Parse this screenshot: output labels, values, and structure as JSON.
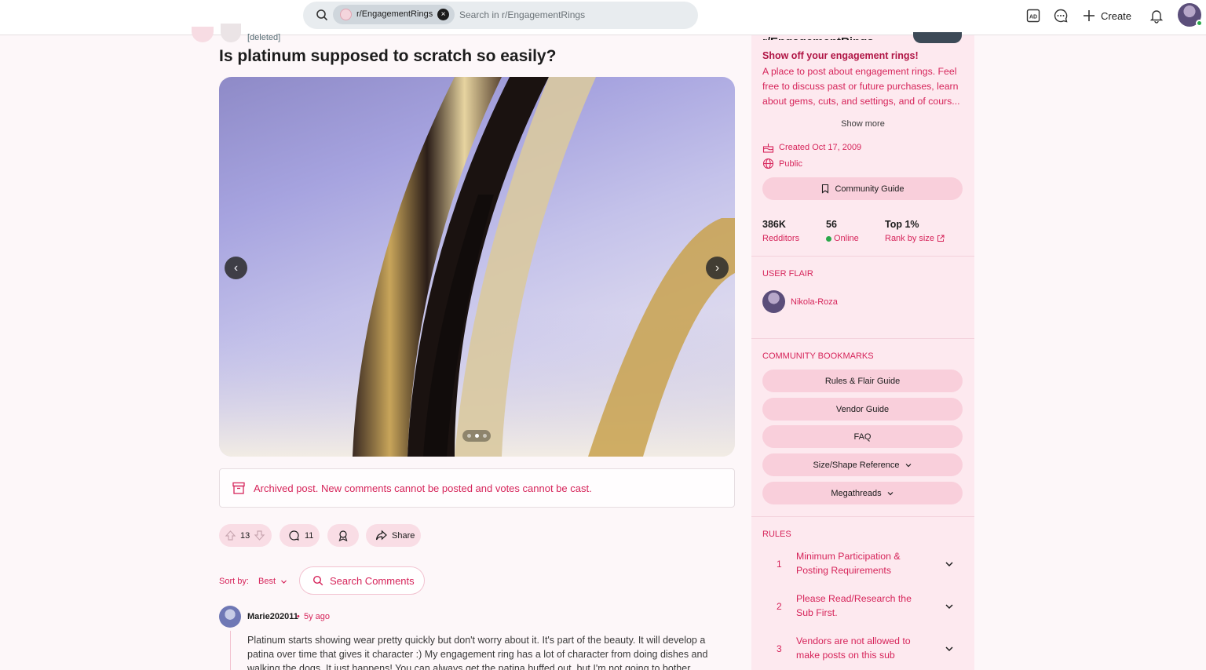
{
  "header": {
    "search_chip_label": "r/EngagementRings",
    "search_placeholder": "Search in r/EngagementRings",
    "create_label": "Create"
  },
  "post": {
    "author": "[deleted]",
    "title": "Is platinum supposed to scratch so easily?",
    "gallery_index": 2,
    "gallery_count": 3,
    "archived_text": "Archived post. New comments cannot be posted and votes cannot be cast.",
    "votes": "13",
    "comments": "11",
    "share_label": "Share"
  },
  "comments_area": {
    "sort_label": "Sort by:",
    "sort_value": "Best",
    "search_label": "Search Comments",
    "first_comment": {
      "user": "Marie202011",
      "separator": "•",
      "time": "5y ago",
      "body": "Platinum starts showing wear pretty quickly but don't worry about it. It's part of the beauty. It will develop a patina over time that gives it character :) My engagement ring has a lot of character from doing dishes and walking the dogs. It just happens! You can always get the patina buffed out, but I'm not going to bother."
    }
  },
  "sidebar": {
    "community_name": "r/EngagementRings",
    "tagline": "Show off your engagement rings!",
    "description": "A place to post about engagement rings. Feel free to discuss past or future purchases, learn about gems, cuts, and settings, and of cours...",
    "show_more": "Show more",
    "created": "Created Oct 17, 2009",
    "visibility": "Public",
    "community_guide": "Community Guide",
    "stats": [
      {
        "value": "386K",
        "label": "Redditors"
      },
      {
        "value": "56",
        "label": "Online"
      },
      {
        "value": "Top 1%",
        "label": "Rank by size"
      }
    ],
    "user_flair_heading": "USER FLAIR",
    "user_flair_name": "Nikola-Roza",
    "bookmarks_heading": "COMMUNITY BOOKMARKS",
    "bookmarks": [
      "Rules & Flair Guide",
      "Vendor Guide",
      "FAQ",
      "Size/Shape Reference",
      "Megathreads"
    ],
    "rules_heading": "RULES",
    "rules": [
      {
        "num": "1",
        "text": "Minimum Participation & Posting Requirements"
      },
      {
        "num": "2",
        "text": "Please Read/Research the Sub First."
      },
      {
        "num": "3",
        "text": "Vendors are not allowed to make posts on this sub"
      }
    ]
  },
  "colors": {
    "accent": "#d6245a",
    "sidebar_bg": "#fde9ef",
    "pill_bg": "#f9cfdb"
  }
}
